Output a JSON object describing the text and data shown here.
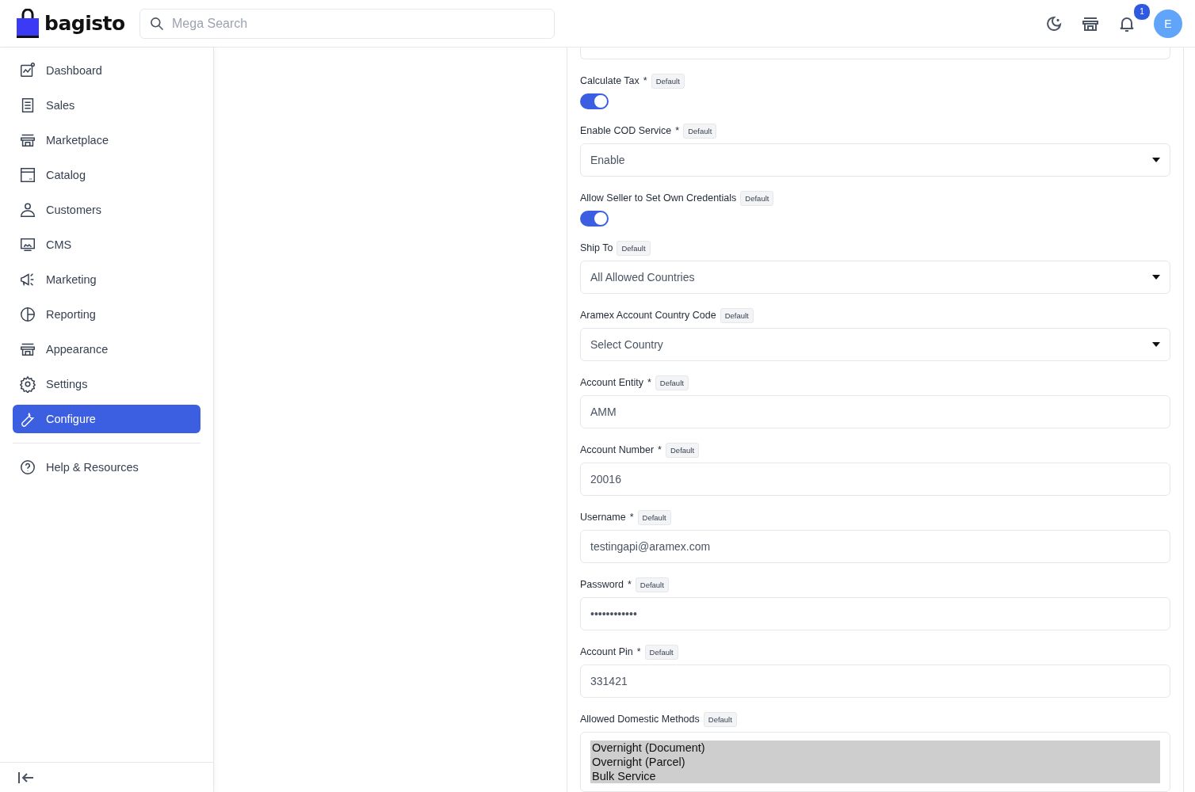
{
  "header": {
    "logo": "bagisto",
    "search": {
      "placeholder": "Mega Search"
    },
    "notifications": {
      "count": "1"
    },
    "avatar": {
      "initial": "E"
    }
  },
  "sidebar": {
    "items": [
      {
        "label": "Dashboard",
        "selected": false
      },
      {
        "label": "Sales",
        "selected": false
      },
      {
        "label": "Marketplace",
        "selected": false
      },
      {
        "label": "Catalog",
        "selected": false
      },
      {
        "label": "Customers",
        "selected": false
      },
      {
        "label": "CMS",
        "selected": false
      },
      {
        "label": "Marketing",
        "selected": false
      },
      {
        "label": "Reporting",
        "selected": false
      },
      {
        "label": "Appearance",
        "selected": false
      },
      {
        "label": "Settings",
        "selected": false
      },
      {
        "label": "Configure",
        "selected": true
      }
    ],
    "footer_items": [
      {
        "label": "Help & Resources",
        "selected": false
      }
    ]
  },
  "form": {
    "fields": [
      {
        "kind": "toggle",
        "label": "Calculate Tax",
        "mark": "*",
        "badge": "Default",
        "on": true
      },
      {
        "kind": "select",
        "label": "Enable COD Service",
        "mark": "*",
        "badge": "Default",
        "value": "Enable"
      },
      {
        "kind": "toggle",
        "label": "Allow Seller to Set Own Credentials",
        "badge": "Default",
        "on": true
      },
      {
        "kind": "select",
        "label": "Ship To",
        "badge": "Default",
        "value": "All Allowed Countries"
      },
      {
        "kind": "select",
        "label": "Aramex Account Country Code",
        "badge": "Default",
        "value": "Select Country"
      },
      {
        "kind": "text",
        "label": "Account Entity",
        "mark": "*",
        "badge": "Default",
        "value": "AMM"
      },
      {
        "kind": "text",
        "label": "Account Number",
        "mark": "*",
        "badge": "Default",
        "value": "20016"
      },
      {
        "kind": "text",
        "label": "Username",
        "mark": "*",
        "badge": "Default",
        "value": "testingapi@aramex.com"
      },
      {
        "kind": "password",
        "label": "Password",
        "mark": "*",
        "badge": "Default",
        "value": "••••••••••••"
      },
      {
        "kind": "text",
        "label": "Account Pin",
        "mark": "*",
        "badge": "Default",
        "value": "331421"
      },
      {
        "kind": "multiselect",
        "label": "Allowed Domestic Methods",
        "badge": "Default",
        "options": [
          {
            "label": "Overnight (Document)",
            "selected": true
          },
          {
            "label": "Overnight (Parcel)",
            "selected": true
          },
          {
            "label": "Bulk Service",
            "selected": true
          }
        ]
      }
    ]
  }
}
